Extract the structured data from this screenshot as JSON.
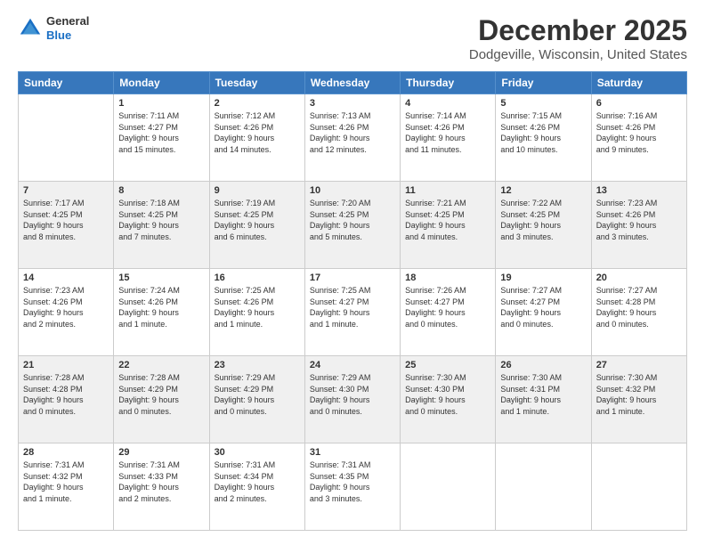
{
  "logo": {
    "general": "General",
    "blue": "Blue"
  },
  "header": {
    "title": "December 2025",
    "subtitle": "Dodgeville, Wisconsin, United States"
  },
  "weekdays": [
    "Sunday",
    "Monday",
    "Tuesday",
    "Wednesday",
    "Thursday",
    "Friday",
    "Saturday"
  ],
  "weeks": [
    [
      {
        "num": "",
        "info": ""
      },
      {
        "num": "1",
        "info": "Sunrise: 7:11 AM\nSunset: 4:27 PM\nDaylight: 9 hours\nand 15 minutes."
      },
      {
        "num": "2",
        "info": "Sunrise: 7:12 AM\nSunset: 4:26 PM\nDaylight: 9 hours\nand 14 minutes."
      },
      {
        "num": "3",
        "info": "Sunrise: 7:13 AM\nSunset: 4:26 PM\nDaylight: 9 hours\nand 12 minutes."
      },
      {
        "num": "4",
        "info": "Sunrise: 7:14 AM\nSunset: 4:26 PM\nDaylight: 9 hours\nand 11 minutes."
      },
      {
        "num": "5",
        "info": "Sunrise: 7:15 AM\nSunset: 4:26 PM\nDaylight: 9 hours\nand 10 minutes."
      },
      {
        "num": "6",
        "info": "Sunrise: 7:16 AM\nSunset: 4:26 PM\nDaylight: 9 hours\nand 9 minutes."
      }
    ],
    [
      {
        "num": "7",
        "info": "Sunrise: 7:17 AM\nSunset: 4:25 PM\nDaylight: 9 hours\nand 8 minutes."
      },
      {
        "num": "8",
        "info": "Sunrise: 7:18 AM\nSunset: 4:25 PM\nDaylight: 9 hours\nand 7 minutes."
      },
      {
        "num": "9",
        "info": "Sunrise: 7:19 AM\nSunset: 4:25 PM\nDaylight: 9 hours\nand 6 minutes."
      },
      {
        "num": "10",
        "info": "Sunrise: 7:20 AM\nSunset: 4:25 PM\nDaylight: 9 hours\nand 5 minutes."
      },
      {
        "num": "11",
        "info": "Sunrise: 7:21 AM\nSunset: 4:25 PM\nDaylight: 9 hours\nand 4 minutes."
      },
      {
        "num": "12",
        "info": "Sunrise: 7:22 AM\nSunset: 4:25 PM\nDaylight: 9 hours\nand 3 minutes."
      },
      {
        "num": "13",
        "info": "Sunrise: 7:23 AM\nSunset: 4:26 PM\nDaylight: 9 hours\nand 3 minutes."
      }
    ],
    [
      {
        "num": "14",
        "info": "Sunrise: 7:23 AM\nSunset: 4:26 PM\nDaylight: 9 hours\nand 2 minutes."
      },
      {
        "num": "15",
        "info": "Sunrise: 7:24 AM\nSunset: 4:26 PM\nDaylight: 9 hours\nand 1 minute."
      },
      {
        "num": "16",
        "info": "Sunrise: 7:25 AM\nSunset: 4:26 PM\nDaylight: 9 hours\nand 1 minute."
      },
      {
        "num": "17",
        "info": "Sunrise: 7:25 AM\nSunset: 4:27 PM\nDaylight: 9 hours\nand 1 minute."
      },
      {
        "num": "18",
        "info": "Sunrise: 7:26 AM\nSunset: 4:27 PM\nDaylight: 9 hours\nand 0 minutes."
      },
      {
        "num": "19",
        "info": "Sunrise: 7:27 AM\nSunset: 4:27 PM\nDaylight: 9 hours\nand 0 minutes."
      },
      {
        "num": "20",
        "info": "Sunrise: 7:27 AM\nSunset: 4:28 PM\nDaylight: 9 hours\nand 0 minutes."
      }
    ],
    [
      {
        "num": "21",
        "info": "Sunrise: 7:28 AM\nSunset: 4:28 PM\nDaylight: 9 hours\nand 0 minutes."
      },
      {
        "num": "22",
        "info": "Sunrise: 7:28 AM\nSunset: 4:29 PM\nDaylight: 9 hours\nand 0 minutes."
      },
      {
        "num": "23",
        "info": "Sunrise: 7:29 AM\nSunset: 4:29 PM\nDaylight: 9 hours\nand 0 minutes."
      },
      {
        "num": "24",
        "info": "Sunrise: 7:29 AM\nSunset: 4:30 PM\nDaylight: 9 hours\nand 0 minutes."
      },
      {
        "num": "25",
        "info": "Sunrise: 7:30 AM\nSunset: 4:30 PM\nDaylight: 9 hours\nand 0 minutes."
      },
      {
        "num": "26",
        "info": "Sunrise: 7:30 AM\nSunset: 4:31 PM\nDaylight: 9 hours\nand 1 minute."
      },
      {
        "num": "27",
        "info": "Sunrise: 7:30 AM\nSunset: 4:32 PM\nDaylight: 9 hours\nand 1 minute."
      }
    ],
    [
      {
        "num": "28",
        "info": "Sunrise: 7:31 AM\nSunset: 4:32 PM\nDaylight: 9 hours\nand 1 minute."
      },
      {
        "num": "29",
        "info": "Sunrise: 7:31 AM\nSunset: 4:33 PM\nDaylight: 9 hours\nand 2 minutes."
      },
      {
        "num": "30",
        "info": "Sunrise: 7:31 AM\nSunset: 4:34 PM\nDaylight: 9 hours\nand 2 minutes."
      },
      {
        "num": "31",
        "info": "Sunrise: 7:31 AM\nSunset: 4:35 PM\nDaylight: 9 hours\nand 3 minutes."
      },
      {
        "num": "",
        "info": ""
      },
      {
        "num": "",
        "info": ""
      },
      {
        "num": "",
        "info": ""
      }
    ]
  ]
}
